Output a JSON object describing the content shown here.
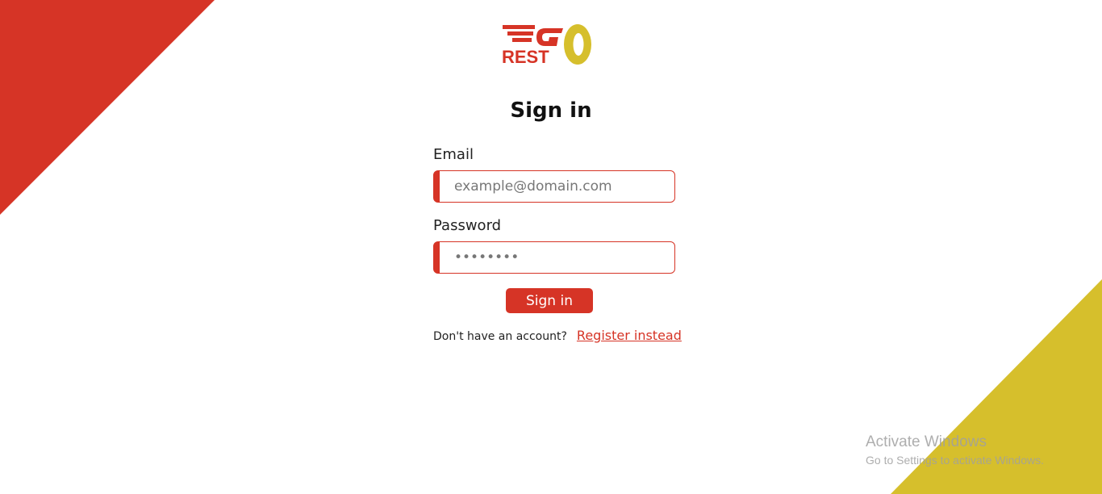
{
  "brand": {
    "logo_word_top": "GO",
    "logo_word_bottom": "REST",
    "primary_color": "#d63426",
    "accent_color": "#d6bf2c"
  },
  "form": {
    "title": "Sign in",
    "email": {
      "label": "Email",
      "placeholder": "example@domain.com",
      "value": ""
    },
    "password": {
      "label": "Password",
      "placeholder": "••••••••",
      "value": ""
    },
    "submit_label": "Sign in",
    "register_prompt": "Don't have an account?",
    "register_link": "Register instead"
  },
  "watermark": {
    "title": "Activate Windows",
    "subtitle": "Go to Settings to activate Windows."
  }
}
